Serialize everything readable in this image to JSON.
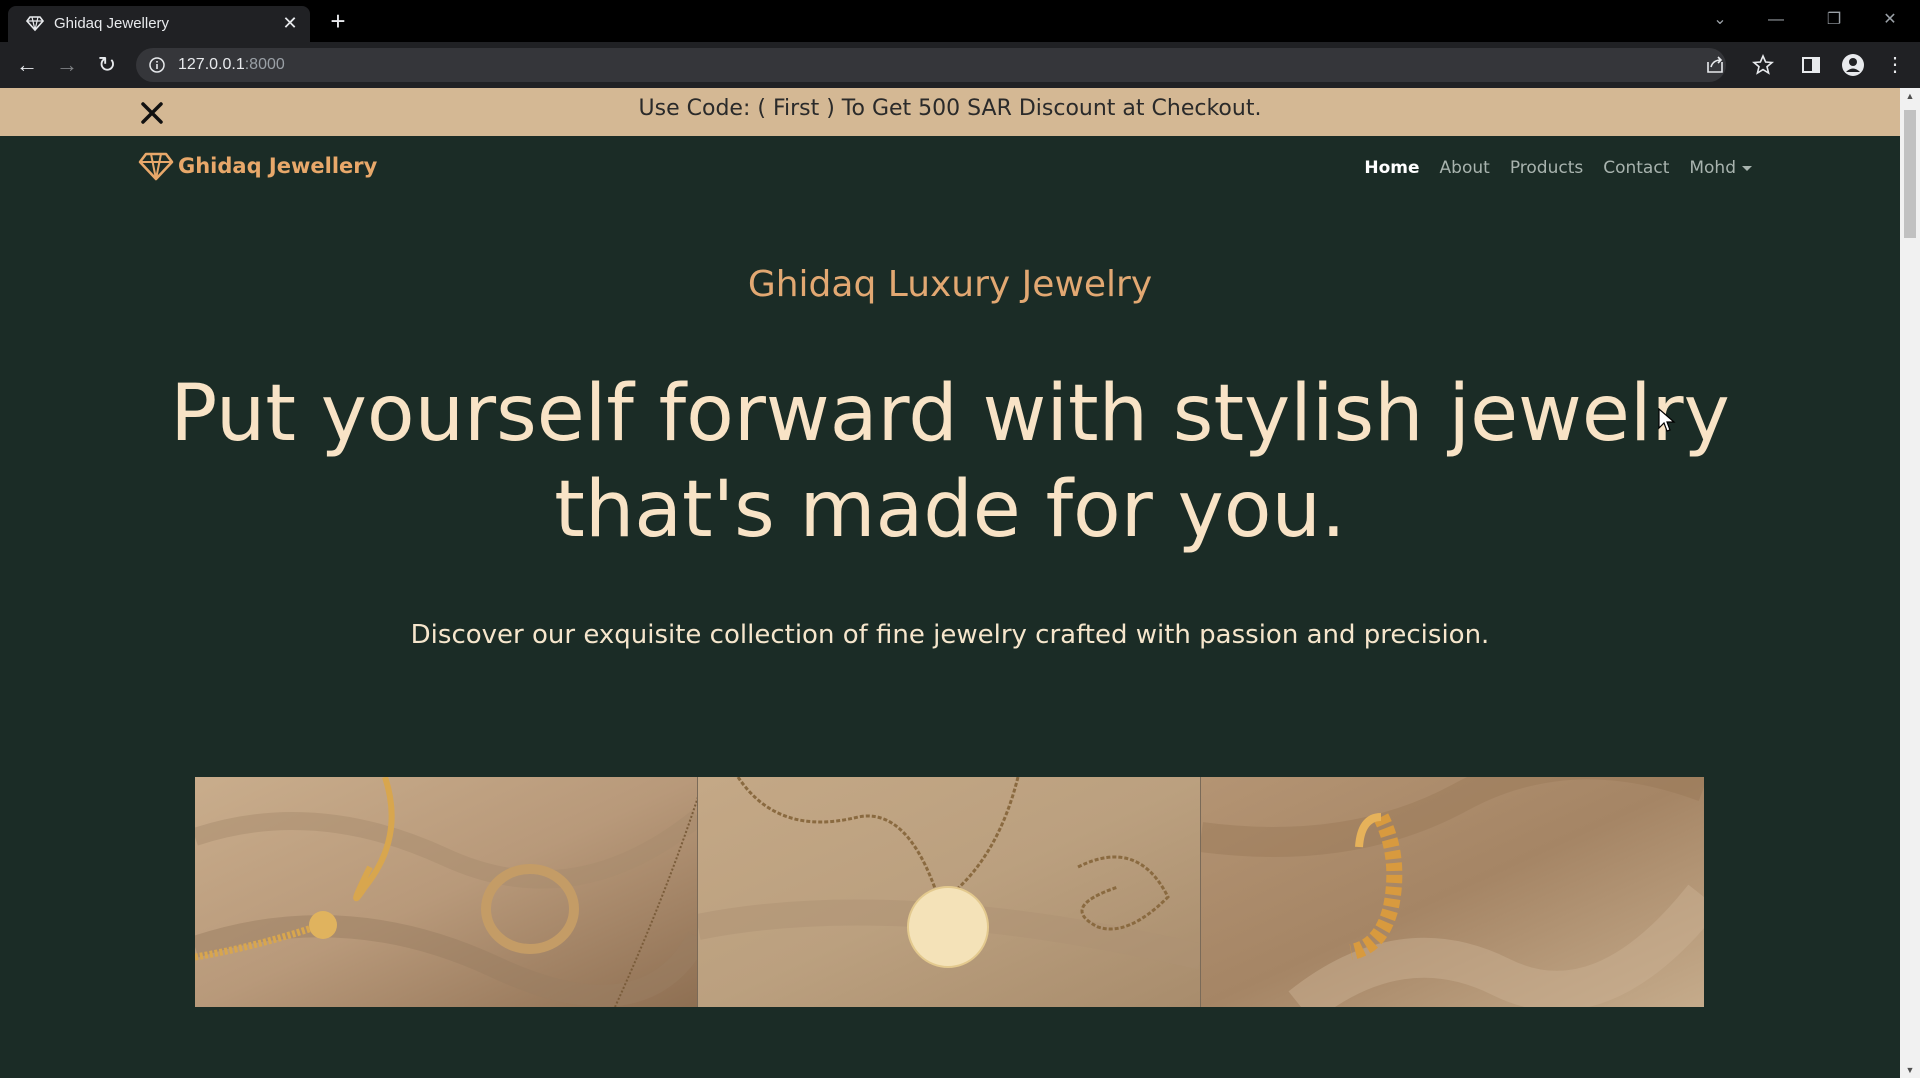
{
  "browser": {
    "tab_title": "Ghidaq Jewellery",
    "url_host": "127.0.0.1",
    "url_port": ":8000"
  },
  "promo": {
    "text": "Use Code: ( First ) To Get 500 SAR Discount at Checkout."
  },
  "navbar": {
    "brand": "Ghidaq Jewellery",
    "links": [
      {
        "label": "Home",
        "active": true
      },
      {
        "label": "About",
        "active": false
      },
      {
        "label": "Products",
        "active": false
      },
      {
        "label": "Contact",
        "active": false
      },
      {
        "label": "Mohd",
        "active": false
      }
    ]
  },
  "hero": {
    "subtitle": "Ghidaq Luxury Jewelry",
    "title_line1": "Put yourself forward with stylish jewelry",
    "title_line2": "that's made for you.",
    "description": "Discover our exquisite collection of fine jewelry crafted with passion and precision."
  },
  "colors": {
    "page_bg": "#1b2c26",
    "promo_bg": "#d4b894",
    "brand": "#e8a86a",
    "accent_text": "#f8e3c6"
  },
  "icons": [
    "diamond-icon",
    "close-icon",
    "back-icon",
    "forward-icon",
    "reload-icon",
    "info-icon",
    "share-icon",
    "star-icon",
    "sidepanel-icon",
    "profile-icon",
    "menu-icon"
  ]
}
